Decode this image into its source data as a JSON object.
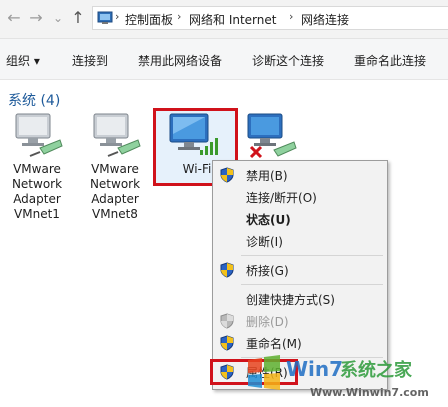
{
  "address": {
    "back": "←",
    "forward": "→",
    "recent": "⌄",
    "up": "↑",
    "separator": "›",
    "crumbs": [
      "控制面板",
      "网络和 Internet",
      "网络连接"
    ]
  },
  "toolbar": {
    "organize": "组织",
    "organize_caret": "▾",
    "connect": "连接到",
    "disable": "禁用此网络设备",
    "diagnose": "诊断这个连接",
    "rename": "重命名此连接"
  },
  "group": {
    "title": "系统 (4)"
  },
  "adapters": [
    {
      "line1": "VMware",
      "line2": "Network",
      "line3": "Adapter",
      "line4": "VMnet1"
    },
    {
      "line1": "VMware",
      "line2": "Network",
      "line3": "Adapter",
      "line4": "VMnet8"
    },
    {
      "line1": "Wi-Fi"
    }
  ],
  "context_menu": {
    "items": [
      {
        "label": "禁用(B)",
        "shield": true,
        "bold": false,
        "disabled": false
      },
      {
        "label": "连接/断开(O)",
        "shield": false,
        "bold": false,
        "disabled": false
      },
      {
        "label": "状态(U)",
        "shield": false,
        "bold": true,
        "disabled": false
      },
      {
        "label": "诊断(I)",
        "shield": false,
        "bold": false,
        "disabled": false
      },
      {
        "label": "桥接(G)",
        "shield": true,
        "bold": false,
        "disabled": false
      },
      {
        "label": "创建快捷方式(S)",
        "shield": false,
        "bold": false,
        "disabled": false
      },
      {
        "label": "删除(D)",
        "shield": true,
        "bold": false,
        "disabled": true
      },
      {
        "label": "重命名(M)",
        "shield": true,
        "bold": false,
        "disabled": false
      },
      {
        "label": "属性(R)",
        "shield": true,
        "bold": false,
        "disabled": false
      }
    ]
  },
  "watermark": {
    "brand": "Win7系统之家",
    "url": "Www.Winwin7.com"
  },
  "colors": {
    "highlight": "#d0121b",
    "group_title": "#1e5a9a",
    "monitor": "#3a7fd0"
  }
}
